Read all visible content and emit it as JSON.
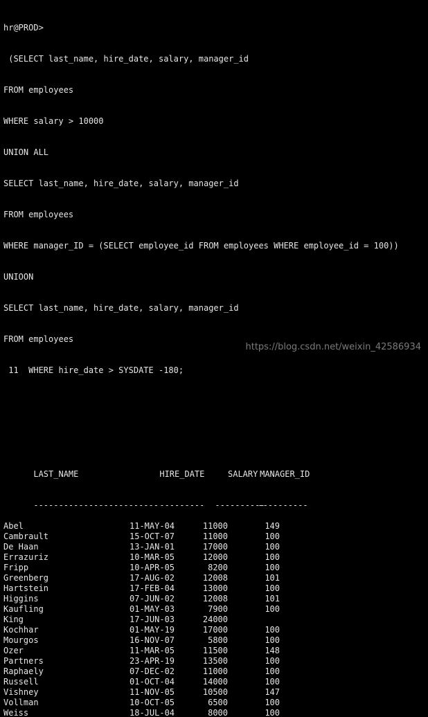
{
  "prompt": "hr@PROD>",
  "sql_lines": [
    " (SELECT last_name, hire_date, salary, manager_id",
    "FROM employees",
    "WHERE salary > 10000",
    "UNION ALL",
    "SELECT last_name, hire_date, salary, manager_id",
    "FROM employees",
    "WHERE manager_ID = (SELECT employee_id FROM employees WHERE employee_id = 100))",
    "UNIOON",
    "SELECT last_name, hire_date, salary, manager_id",
    "FROM employees",
    " 11  WHERE hire_date > SYSDATE -180;"
  ],
  "table": {
    "headers": [
      "LAST_NAME",
      "HIRE_DATE",
      "SALARY",
      "MANAGER_ID"
    ],
    "separators": [
      "-------------------------",
      "---------",
      "----------",
      "----------"
    ],
    "rows": [
      [
        "Abel",
        "11-MAY-04",
        "11000",
        "149"
      ],
      [
        "Cambrault",
        "15-OCT-07",
        "11000",
        "100"
      ],
      [
        "De Haan",
        "13-JAN-01",
        "17000",
        "100"
      ],
      [
        "Errazuriz",
        "10-MAR-05",
        "12000",
        "100"
      ],
      [
        "Fripp",
        "10-APR-05",
        "8200",
        "100"
      ],
      [
        "Greenberg",
        "17-AUG-02",
        "12008",
        "101"
      ],
      [
        "Hartstein",
        "17-FEB-04",
        "13000",
        "100"
      ],
      [
        "Higgins",
        "07-JUN-02",
        "12008",
        "101"
      ],
      [
        "Kaufling",
        "01-MAY-03",
        "7900",
        "100"
      ],
      [
        "King",
        "17-JUN-03",
        "24000",
        ""
      ],
      [
        "Kochhar",
        "01-MAY-19",
        "17000",
        "100"
      ],
      [
        "Mourgos",
        "16-NOV-07",
        "5800",
        "100"
      ],
      [
        "Ozer",
        "11-MAR-05",
        "11500",
        "148"
      ],
      [
        "Partners",
        "23-APR-19",
        "13500",
        "100"
      ],
      [
        "Raphaely",
        "07-DEC-02",
        "11000",
        "100"
      ],
      [
        "Russell",
        "01-OCT-04",
        "14000",
        "100"
      ],
      [
        "Vishney",
        "11-NOV-05",
        "10500",
        "147"
      ],
      [
        "Vollman",
        "10-OCT-05",
        "6500",
        "100"
      ],
      [
        "Weiss",
        "18-JUL-04",
        "8000",
        "100"
      ]
    ]
  },
  "watermark": "https://blog.csdn.net/weixin_42586934"
}
